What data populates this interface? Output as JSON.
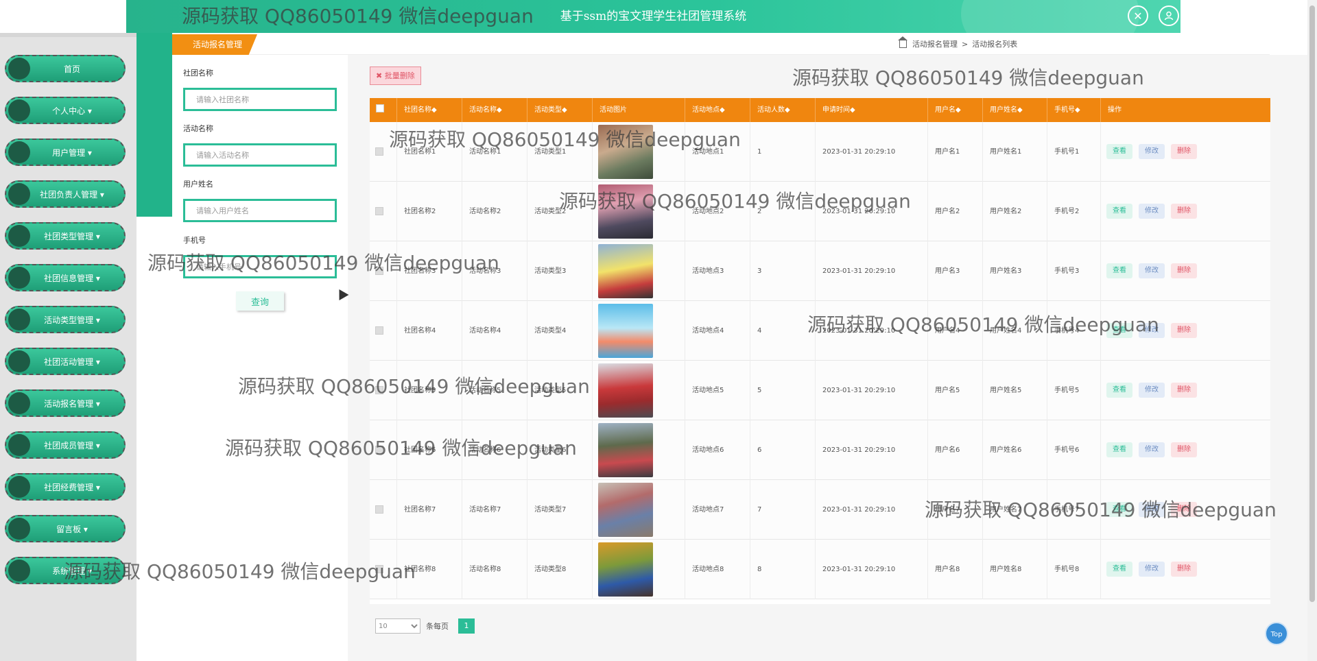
{
  "header": {
    "title": "基于ssm的宝文理学生社团管理系统",
    "close_icon": "close-circle-icon",
    "user_icon": "user-avatar-icon"
  },
  "sidebar": {
    "items": [
      {
        "label": "首页"
      },
      {
        "label": "个人中心 ▾"
      },
      {
        "label": "用户管理 ▾"
      },
      {
        "label": "社团负责人管理 ▾"
      },
      {
        "label": "社团类型管理 ▾"
      },
      {
        "label": "社团信息管理 ▾"
      },
      {
        "label": "活动类型管理 ▾"
      },
      {
        "label": "社团活动管理 ▾"
      },
      {
        "label": "活动报名管理 ▾"
      },
      {
        "label": "社团成员管理 ▾"
      },
      {
        "label": "社团经费管理 ▾"
      },
      {
        "label": "留言板 ▾"
      },
      {
        "label": "系统管理 ▾"
      }
    ]
  },
  "breadcrumb": {
    "tab": "活动报名管理",
    "path1": "活动报名管理",
    "sep": ">",
    "path2": "活动报名列表"
  },
  "filter": {
    "club_label": "社团名称",
    "club_placeholder": "请输入社团名称",
    "activity_label": "活动名称",
    "activity_placeholder": "请输入活动名称",
    "username_label": "用户姓名",
    "username_placeholder": "请输入用户姓名",
    "phone_label": "手机号",
    "phone_placeholder": "请输入手机号",
    "query_label": "查询"
  },
  "toolbar": {
    "batch_delete_label": "批量删除"
  },
  "table": {
    "headers": [
      "社团名称◆",
      "活动名称◆",
      "活动类型◆",
      "活动图片",
      "活动地点◆",
      "活动人数◆",
      "申请时间◆",
      "用户名◆",
      "用户姓名◆",
      "手机号◆",
      "操作"
    ],
    "rows": [
      {
        "club": "社团名称1",
        "activity": "活动名称1",
        "type": "活动类型1",
        "place": "活动地点1",
        "count": "1",
        "time": "2023-01-31 20:29:10",
        "user": "用户名1",
        "name": "用户姓名1",
        "phone": "手机号1"
      },
      {
        "club": "社团名称2",
        "activity": "活动名称2",
        "type": "活动类型2",
        "place": "活动地点2",
        "count": "2",
        "time": "2023-01-31 20:29:10",
        "user": "用户名2",
        "name": "用户姓名2",
        "phone": "手机号2"
      },
      {
        "club": "社团名称3",
        "activity": "活动名称3",
        "type": "活动类型3",
        "place": "活动地点3",
        "count": "3",
        "time": "2023-01-31 20:29:10",
        "user": "用户名3",
        "name": "用户姓名3",
        "phone": "手机号3"
      },
      {
        "club": "社团名称4",
        "activity": "活动名称4",
        "type": "活动类型4",
        "place": "活动地点4",
        "count": "4",
        "time": "2023-01-31 20:29:10",
        "user": "用户名4",
        "name": "用户姓名4",
        "phone": "手机号4"
      },
      {
        "club": "社团名称5",
        "activity": "活动名称5",
        "type": "活动类型5",
        "place": "活动地点5",
        "count": "5",
        "time": "2023-01-31 20:29:10",
        "user": "用户名5",
        "name": "用户姓名5",
        "phone": "手机号5"
      },
      {
        "club": "社团名称6",
        "activity": "活动名称6",
        "type": "活动类型6",
        "place": "活动地点6",
        "count": "6",
        "time": "2023-01-31 20:29:10",
        "user": "用户名6",
        "name": "用户姓名6",
        "phone": "手机号6"
      },
      {
        "club": "社团名称7",
        "activity": "活动名称7",
        "type": "活动类型7",
        "place": "活动地点7",
        "count": "7",
        "time": "2023-01-31 20:29:10",
        "user": "用户名7",
        "name": "用户姓名7",
        "phone": "手机号7"
      },
      {
        "club": "社团名称8",
        "activity": "活动名称8",
        "type": "活动类型8",
        "place": "活动地点8",
        "count": "8",
        "time": "2023-01-31 20:29:10",
        "user": "用户名8",
        "name": "用户姓名8",
        "phone": "手机号8"
      }
    ],
    "view_label": "查看",
    "edit_label": "修改",
    "delete_label": "删除"
  },
  "pager": {
    "page_size": "10",
    "per_page_label": "条每页",
    "current_page": "1"
  },
  "top_button": "Top",
  "watermark": "源码获取 QQ86050149 微信deepguan",
  "colors": {
    "primary": "#2bbd97",
    "table_header": "#f0860f",
    "danger": "#e05566"
  }
}
